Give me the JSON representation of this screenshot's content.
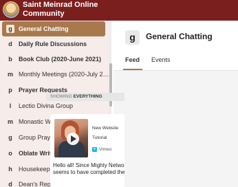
{
  "app": {
    "title": "Saint Meinrad Online Community",
    "brand_color": "#7b1e1e",
    "accent_color": "#a8794d",
    "logo_icon": "community-logo-icon"
  },
  "sidebar": {
    "items": [
      {
        "badge": "g",
        "label": "General Chatting",
        "active": true,
        "bold": true
      },
      {
        "badge": "d",
        "label": "Daily Rule Discussions",
        "active": false,
        "bold": true
      },
      {
        "badge": "b",
        "label": "Book Club (2020-June 2021)",
        "active": false,
        "bold": true
      },
      {
        "badge": "m",
        "label": "Monthly Meetings (2020-July 2…",
        "active": false,
        "bold": false
      },
      {
        "badge": "p",
        "label": "Prayer Requests",
        "active": false,
        "bold": true
      },
      {
        "badge": "l",
        "label": "Lectio Divina Group",
        "active": false,
        "bold": false
      },
      {
        "badge": "m",
        "label": "Monastic Wisdom",
        "active": false,
        "bold": false
      },
      {
        "badge": "g",
        "label": "Group Prayer Recordings",
        "active": false,
        "bold": false
      },
      {
        "badge": "o",
        "label": "Oblate Writings",
        "active": false,
        "bold": true
      },
      {
        "badge": "h",
        "label": "Housekeeping Items",
        "active": false,
        "bold": false
      },
      {
        "badge": "d",
        "label": "Dean's Report",
        "active": false,
        "bold": false
      }
    ]
  },
  "main": {
    "group_badge": "g",
    "group_title": "General Chatting",
    "tabs": [
      {
        "label": "Feed",
        "active": true
      },
      {
        "label": "Events",
        "active": false
      }
    ],
    "filter": {
      "prefix": "SHOWING",
      "value": "EVERYTHING"
    },
    "post": {
      "video_title": "New Website",
      "video_subtitle": "Tutorial",
      "video_source": "Vimeo",
      "text_line_1": "Hello all! Since Mighty Netwo",
      "text_line_2": "seems to have completed the"
    }
  }
}
